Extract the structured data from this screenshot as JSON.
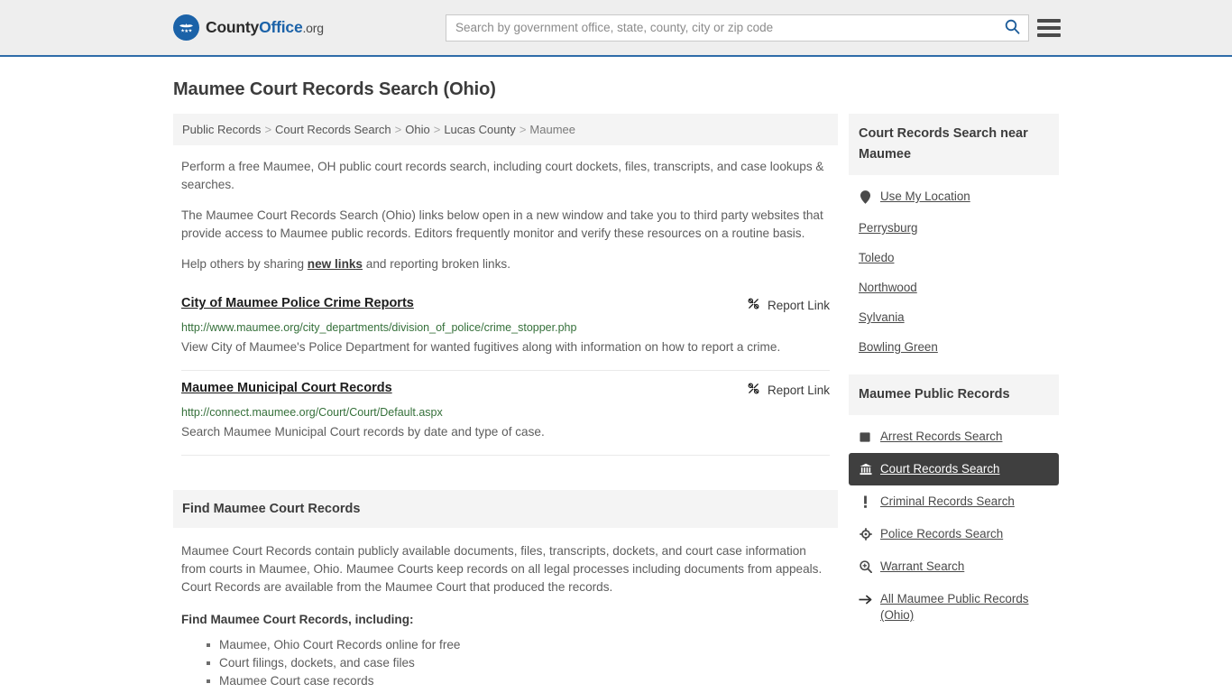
{
  "header": {
    "logo": {
      "part1": "County",
      "part2": "Office",
      "part3": ".org",
      "icon": "eagle-seal-icon"
    },
    "search": {
      "placeholder": "Search by government office, state, county, city or zip code",
      "value": "",
      "icon": "search-icon"
    },
    "menu_icon": "hamburger-menu-icon",
    "accent_color": "#2f6ca8"
  },
  "page": {
    "title": "Maumee Court Records Search (Ohio)"
  },
  "breadcrumb": {
    "items": [
      {
        "label": "Public Records",
        "current": false
      },
      {
        "label": "Court Records Search",
        "current": false
      },
      {
        "label": "Ohio",
        "current": false
      },
      {
        "label": "Lucas County",
        "current": false
      },
      {
        "label": "Maumee",
        "current": true
      }
    ],
    "separator": ">"
  },
  "intro": {
    "p1": "Perform a free Maumee, OH public court records search, including court dockets, files, transcripts, and case lookups & searches.",
    "p2": "The Maumee Court Records Search (Ohio) links below open in a new window and take you to third party websites that provide access to Maumee public records. Editors frequently monitor and verify these resources on a routine basis.",
    "p3_before": "Help others by sharing ",
    "p3_link": "new links",
    "p3_after": " and reporting broken links."
  },
  "results": {
    "report_label": "Report Link",
    "report_icon": "broken-link-icon",
    "items": [
      {
        "title": "City of Maumee Police Crime Reports",
        "url": "http://www.maumee.org/city_departments/division_of_police/crime_stopper.php",
        "description": "View City of Maumee's Police Department for wanted fugitives along with information on how to report a crime."
      },
      {
        "title": "Maumee Municipal Court Records",
        "url": "http://connect.maumee.org/Court/Court/Default.aspx",
        "description": "Search Maumee Municipal Court records by date and type of case."
      }
    ]
  },
  "find_section": {
    "header": "Find Maumee Court Records",
    "body": "Maumee Court Records contain publicly available documents, files, transcripts, dockets, and court case information from courts in Maumee, Ohio. Maumee Courts keep records on all legal processes including documents from appeals. Court Records are available from the Maumee Court that produced the records.",
    "list_title": "Find Maumee Court Records, including:",
    "list_items": [
      "Maumee, Ohio Court Records online for free",
      "Court filings, dockets, and case files",
      "Maumee Court case records"
    ]
  },
  "sidebar": {
    "nearby": {
      "header": "Court Records Search near Maumee",
      "use_location": {
        "label": "Use My Location",
        "icon": "map-pin-icon"
      },
      "cities": [
        {
          "label": "Perrysburg"
        },
        {
          "label": "Toledo"
        },
        {
          "label": "Northwood"
        },
        {
          "label": "Sylvania"
        },
        {
          "label": "Bowling Green"
        }
      ]
    },
    "public_records": {
      "header": "Maumee Public Records",
      "active_color": "#3f3f3f",
      "items": [
        {
          "label": "Arrest Records Search",
          "icon": "square-badge-icon",
          "active": false
        },
        {
          "label": "Court Records Search",
          "icon": "courthouse-icon",
          "active": true
        },
        {
          "label": "Criminal Records Search",
          "icon": "exclamation-icon",
          "active": false
        },
        {
          "label": "Police Records Search",
          "icon": "crosshair-icon",
          "active": false
        },
        {
          "label": "Warrant Search",
          "icon": "magnifier-plus-icon",
          "active": false
        },
        {
          "label": "All Maumee Public Records (Ohio)",
          "icon": "arrow-right-icon",
          "active": false
        }
      ]
    }
  }
}
